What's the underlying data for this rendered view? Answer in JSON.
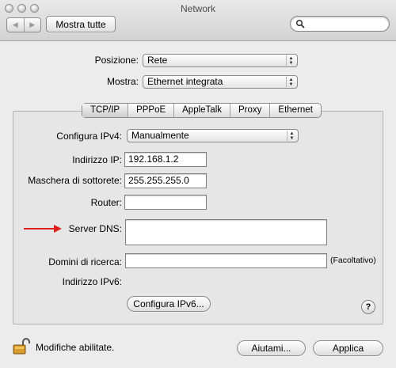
{
  "window": {
    "title": "Network"
  },
  "toolbar": {
    "back_icon": "left-arrow-icon",
    "forward_icon": "right-arrow-icon",
    "show_all_label": "Mostra tutte",
    "search_icon": "magnifier-icon",
    "search_value": ""
  },
  "location": {
    "label": "Posizione:",
    "value": "Rete"
  },
  "show": {
    "label": "Mostra:",
    "value": "Ethernet integrata"
  },
  "tabs": [
    {
      "label": "TCP/IP",
      "active": true
    },
    {
      "label": "PPPoE"
    },
    {
      "label": "AppleTalk"
    },
    {
      "label": "Proxy"
    },
    {
      "label": "Ethernet"
    }
  ],
  "tcpip": {
    "configure_label": "Configura IPv4:",
    "configure_value": "Manualmente",
    "ip_label": "Indirizzo IP:",
    "ip_value": "192.168.1.2",
    "subnet_label": "Maschera di sottorete:",
    "subnet_value": "255.255.255.0",
    "router_label": "Router:",
    "router_value": "",
    "dns_label": "Server DNS:",
    "dns_value": "",
    "search_domains_label": "Domini di ricerca:",
    "search_domains_value": "",
    "optional_label": "(Facoltativo)",
    "ipv6_label": "Indirizzo IPv6:",
    "ipv6_button": "Configura IPv6...",
    "help_label": "?"
  },
  "footer": {
    "lock_icon": "padlock-icon",
    "lock_label": "Modifiche abilitate.",
    "help_button": "Aiutami...",
    "apply_button": "Applica"
  },
  "colors": {
    "annotation_arrow": "#e02020"
  }
}
